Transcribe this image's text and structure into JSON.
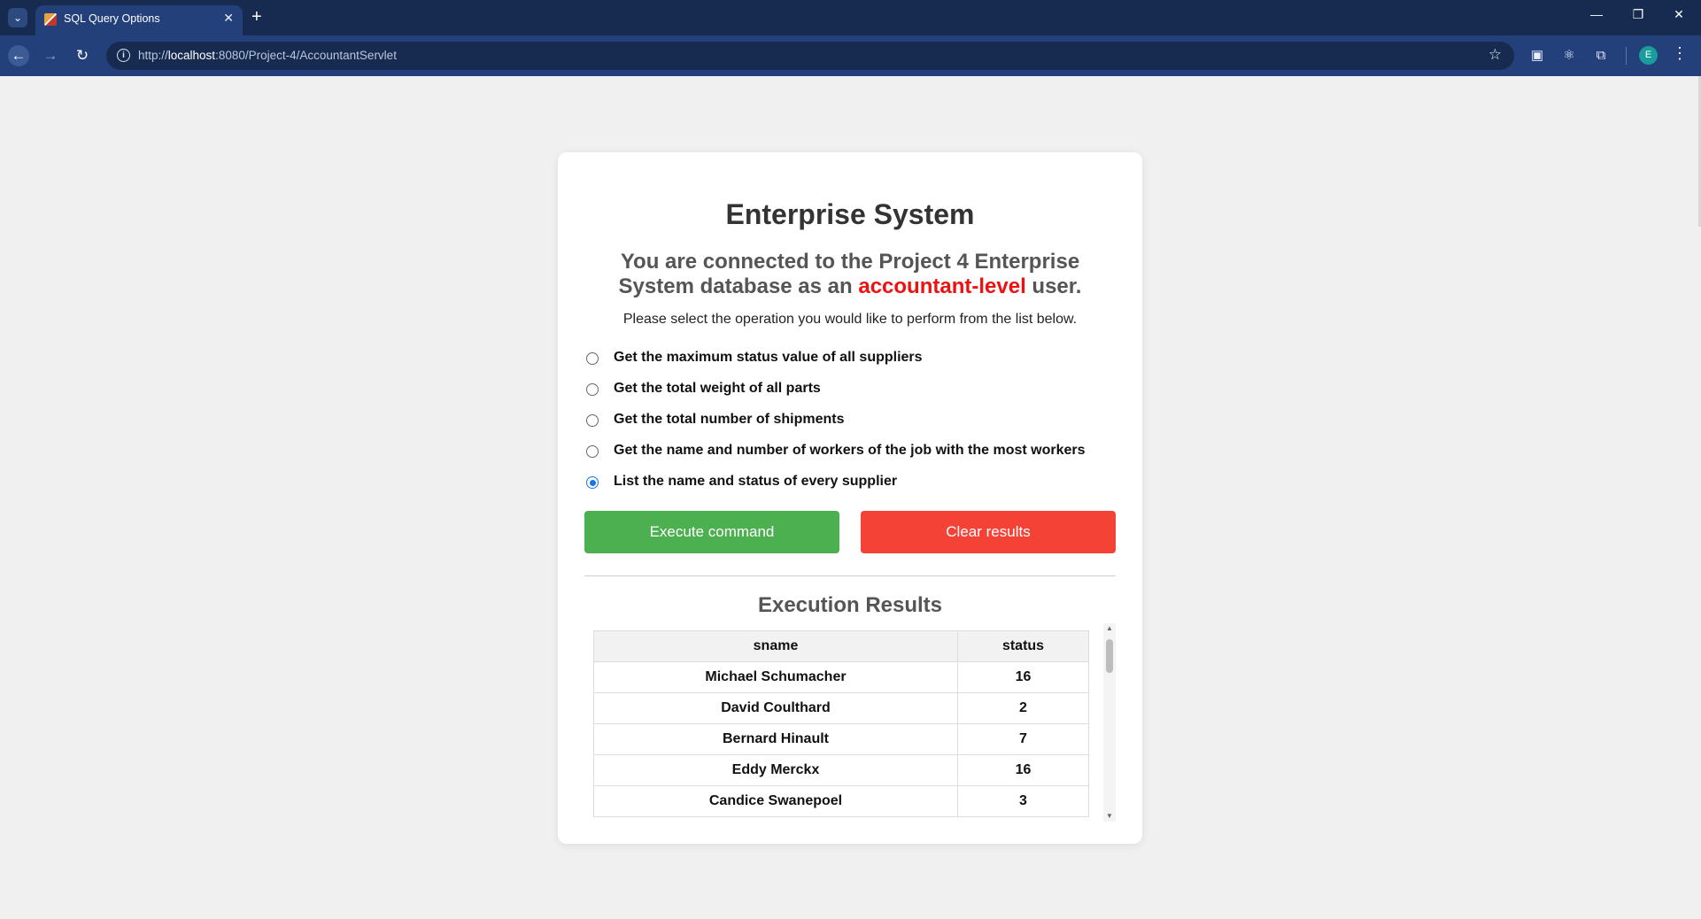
{
  "browser": {
    "tab_title": "SQL Query Options",
    "url_scheme": "http://",
    "url_host": "localhost",
    "url_path": ":8080/Project-4/AccountantServlet",
    "avatar_letter": "E"
  },
  "page": {
    "title": "Enterprise System",
    "subtitle_pre": "You are connected to the Project 4 Enterprise System database as an ",
    "subtitle_highlight": "accountant-level",
    "subtitle_post": " user.",
    "instructions": "Please select the operation you would like to perform from the list below.",
    "options": [
      {
        "label": "Get the maximum status value of all suppliers",
        "selected": false
      },
      {
        "label": "Get the total weight of all parts",
        "selected": false
      },
      {
        "label": "Get the total number of shipments",
        "selected": false
      },
      {
        "label": "Get the name and number of workers of the job with the most workers",
        "selected": false
      },
      {
        "label": "List the name and status of every supplier",
        "selected": true
      }
    ],
    "execute_label": "Execute command",
    "clear_label": "Clear results",
    "results_title": "Execution Results",
    "results": {
      "columns": [
        "sname",
        "status"
      ],
      "rows": [
        [
          "Michael Schumacher",
          "16"
        ],
        [
          "David Coulthard",
          "2"
        ],
        [
          "Bernard Hinault",
          "7"
        ],
        [
          "Eddy Merckx",
          "16"
        ],
        [
          "Candice Swanepoel",
          "3"
        ]
      ]
    }
  },
  "colors": {
    "execute_button": "#4caf50",
    "clear_button": "#f44336",
    "highlight_text": "#ee1111",
    "browser_frame": "#23407a"
  }
}
